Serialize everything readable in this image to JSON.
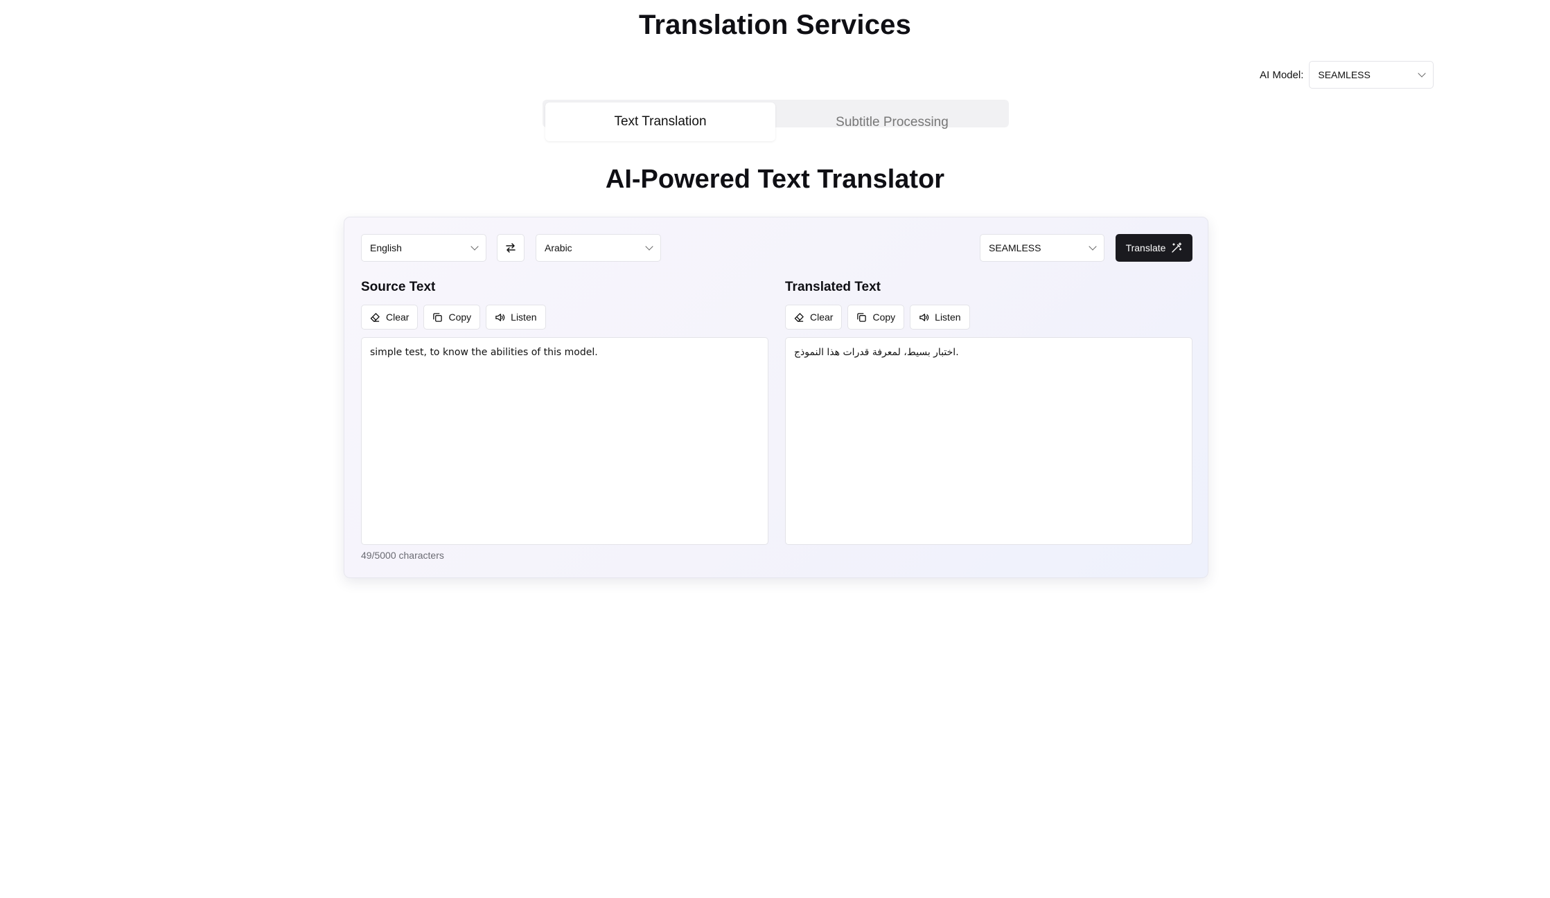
{
  "page_title": "Translation Services",
  "model_picker": {
    "label": "AI Model:",
    "value": "SEAMLESS"
  },
  "tabs": [
    {
      "label": "Text Translation",
      "active": true
    },
    {
      "label": "Subtitle Processing",
      "active": false
    }
  ],
  "section_title": "AI-Powered Text Translator",
  "translator": {
    "source_language": "English",
    "target_language": "Arabic",
    "model": "SEAMLESS",
    "translate_label": "Translate",
    "source": {
      "title": "Source Text",
      "actions": {
        "clear": "Clear",
        "copy": "Copy",
        "listen": "Listen"
      },
      "text": "simple test, to know the abilities of this model."
    },
    "target": {
      "title": "Translated Text",
      "actions": {
        "clear": "Clear",
        "copy": "Copy",
        "listen": "Listen"
      },
      "text": "اختبار بسيط، لمعرفة قدرات هذا النموذج."
    },
    "char_count": "49/5000 characters"
  },
  "icons": {
    "clear": "eraser-icon",
    "copy": "copy-icon",
    "listen": "speaker-icon",
    "swap": "swap-arrows-icon",
    "translate": "magic-wand-icon",
    "dropdown": "chevron-down-icon"
  },
  "colors": {
    "primary_button": "#1a1a1f",
    "card_tint": "#f4f3fb"
  }
}
